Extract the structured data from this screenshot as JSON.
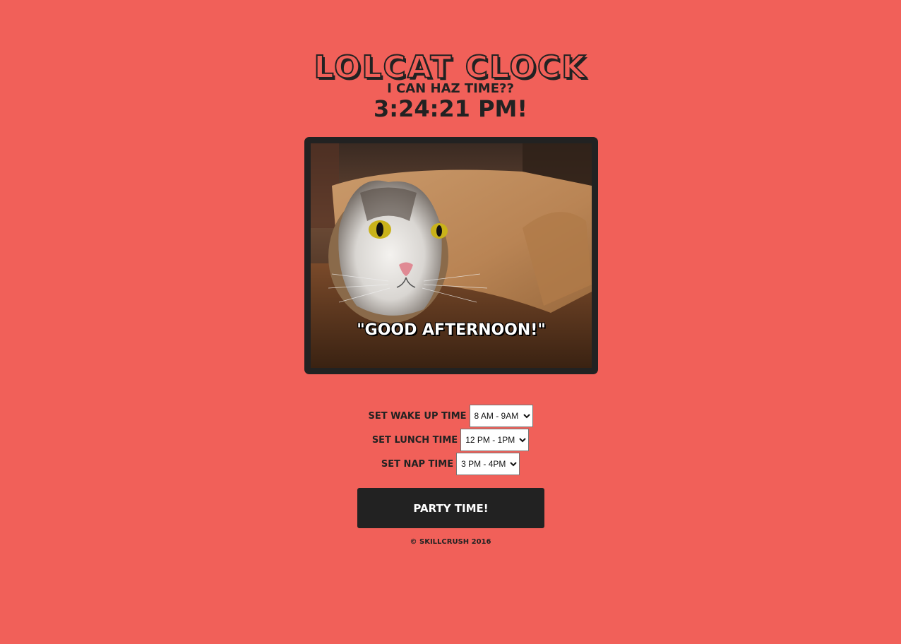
{
  "header": {
    "title": "Lolcat Clock",
    "subtitle": "I can haz time??",
    "clock": "3:24:21 PM!"
  },
  "image": {
    "caption": "\"GOOD AFTERNOON!\""
  },
  "settings": {
    "wake": {
      "label": "Set wake up time",
      "selected": "8 AM - 9AM"
    },
    "lunch": {
      "label": "Set lunch time",
      "selected": "12 PM - 1PM"
    },
    "nap": {
      "label": "Set nap time",
      "selected": "3 PM - 4PM"
    }
  },
  "button": {
    "label": "Party time!"
  },
  "footer": {
    "text": "© Skillcrush 2016"
  },
  "colors": {
    "background": "#f16059",
    "dark": "#222222",
    "button_text": "#ffffff"
  }
}
